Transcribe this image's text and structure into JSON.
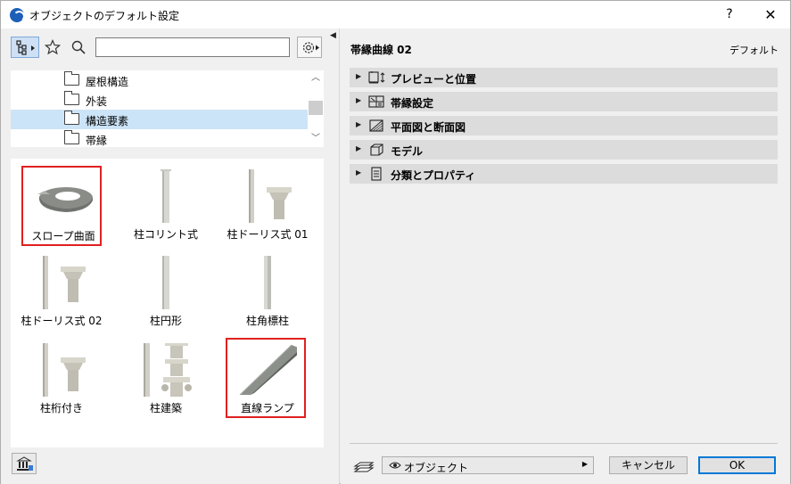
{
  "window": {
    "title": "オブジェクトのデフォルト設定",
    "help": "?",
    "close": "✕"
  },
  "left": {
    "search": {
      "value": "",
      "placeholder": ""
    },
    "tree": [
      {
        "label": "屋根構造",
        "selected": false
      },
      {
        "label": "外装",
        "selected": false
      },
      {
        "label": "構造要素",
        "selected": true
      },
      {
        "label": "帯縁",
        "selected": false
      }
    ],
    "items": [
      {
        "label": "スロープ曲面",
        "highlighted": true,
        "thumb": "ramp-curved"
      },
      {
        "label": "柱コリント式",
        "highlighted": false,
        "thumb": "column-slim"
      },
      {
        "label": "柱ドーリス式 01",
        "highlighted": false,
        "thumb": "column-capital"
      },
      {
        "label": "柱ドーリス式 02",
        "highlighted": false,
        "thumb": "column-capital"
      },
      {
        "label": "柱円形",
        "highlighted": false,
        "thumb": "column-slim"
      },
      {
        "label": "柱角標柱",
        "highlighted": false,
        "thumb": "column-slim"
      },
      {
        "label": "柱桁付き",
        "highlighted": false,
        "thumb": "column-capital"
      },
      {
        "label": "柱建築",
        "highlighted": false,
        "thumb": "column-capital"
      },
      {
        "label": "直線ランプ",
        "highlighted": true,
        "thumb": "ramp-straight"
      }
    ]
  },
  "right": {
    "title": "帯縁曲線 02",
    "default_label": "デフォルト",
    "panels": [
      {
        "label": "プレビューと位置",
        "icon": "preview-icon"
      },
      {
        "label": "帯縁設定",
        "icon": "settings-grid-icon"
      },
      {
        "label": "平面図と断面図",
        "icon": "floorplan-icon"
      },
      {
        "label": "モデル",
        "icon": "cube-icon"
      },
      {
        "label": "分類とプロパティ",
        "icon": "document-icon"
      }
    ],
    "footer": {
      "view_label": "オブジェクト",
      "cancel": "キャンセル",
      "ok": "OK"
    }
  },
  "colors": {
    "highlight": "#e02020",
    "selection": "#cce4f7",
    "ok_border": "#0078d7"
  }
}
